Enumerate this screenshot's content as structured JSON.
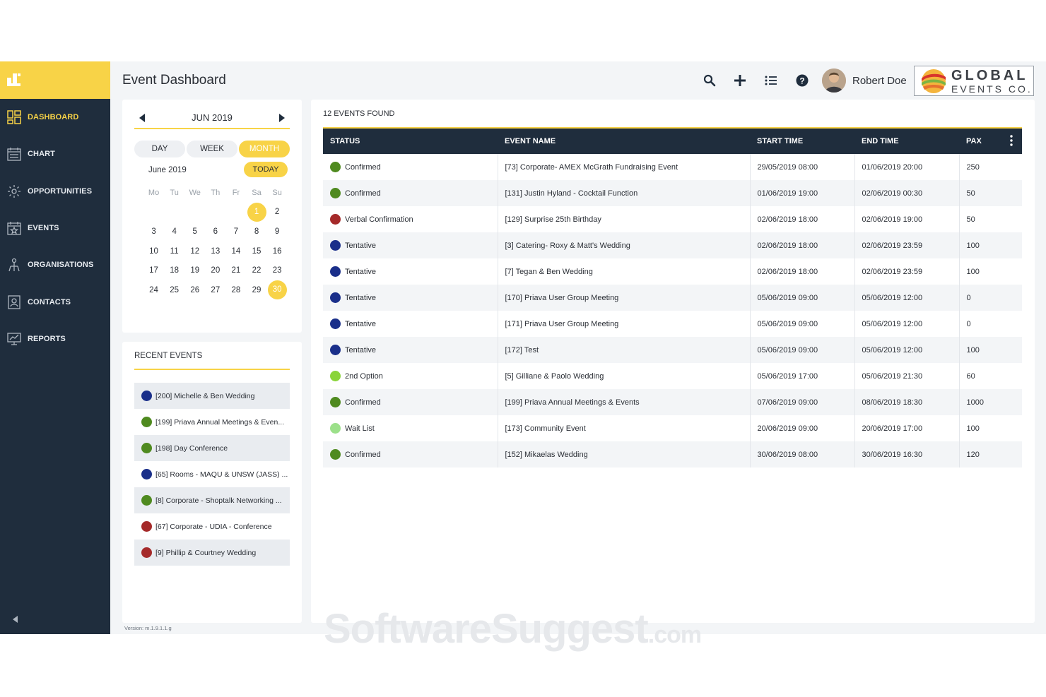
{
  "sidebar": {
    "items": [
      {
        "label": "DASHBOARD",
        "icon": "dashboard-icon",
        "active": true
      },
      {
        "label": "CHART",
        "icon": "chart-calendar-icon",
        "active": false
      },
      {
        "label": "OPPORTUNITIES",
        "icon": "opportunities-icon",
        "active": false
      },
      {
        "label": "EVENTS",
        "icon": "events-icon",
        "active": false
      },
      {
        "label": "ORGANISATIONS",
        "icon": "organisations-icon",
        "active": false
      },
      {
        "label": "CONTACTS",
        "icon": "contacts-icon",
        "active": false
      },
      {
        "label": "REPORTS",
        "icon": "reports-icon",
        "active": false
      }
    ]
  },
  "header": {
    "title": "Event Dashboard",
    "user_name": "Robert Doe",
    "brand_line1": "GLOBAL",
    "brand_line2": "EVENTS CO."
  },
  "calendar": {
    "month_label": "JUN 2019",
    "views": [
      "DAY",
      "WEEK",
      "MONTH"
    ],
    "active_view": "MONTH",
    "current_label": "June 2019",
    "today_label": "TODAY",
    "weekdays": [
      "Mo",
      "Tu",
      "We",
      "Th",
      "Fr",
      "Sa",
      "Su"
    ],
    "weeks": [
      [
        "",
        "",
        "",
        "",
        "",
        "1",
        "2"
      ],
      [
        "3",
        "4",
        "5",
        "6",
        "7",
        "8",
        "9"
      ],
      [
        "10",
        "11",
        "12",
        "13",
        "14",
        "15",
        "16"
      ],
      [
        "17",
        "18",
        "19",
        "20",
        "21",
        "22",
        "23"
      ],
      [
        "24",
        "25",
        "26",
        "27",
        "28",
        "29",
        "30"
      ]
    ],
    "highlighted_days": [
      "1",
      "30"
    ]
  },
  "recent": {
    "title": "RECENT EVENTS",
    "items": [
      {
        "label": "[200] Michelle & Ben Wedding",
        "color": "#1a2f8a"
      },
      {
        "label": "[199] Priava Annual Meetings & Even...",
        "color": "#4f8a1f"
      },
      {
        "label": "[198] Day Conference",
        "color": "#4f8a1f"
      },
      {
        "label": "[65] Rooms - MAQU & UNSW (JASS) ...",
        "color": "#1a2f8a"
      },
      {
        "label": "[8] Corporate - Shoptalk Networking ...",
        "color": "#4f8a1f"
      },
      {
        "label": "[67] Corporate - UDIA - Conference",
        "color": "#a52a2a"
      },
      {
        "label": "[9] Phillip & Courtney Wedding",
        "color": "#a52a2a"
      }
    ]
  },
  "version": "Version: m.1.9.1.1.g",
  "events": {
    "found_label": "12 EVENTS FOUND",
    "columns": [
      "STATUS",
      "EVENT NAME",
      "START TIME",
      "END TIME",
      "PAX"
    ],
    "rows": [
      {
        "status": "Confirmed",
        "color": "#4f8a1f",
        "name": "[73] Corporate- AMEX McGrath Fundraising Event",
        "start": "29/05/2019 08:00",
        "end": "01/06/2019 20:00",
        "pax": "250"
      },
      {
        "status": "Confirmed",
        "color": "#4f8a1f",
        "name": "[131] Justin Hyland - Cocktail Function",
        "start": "01/06/2019 19:00",
        "end": "02/06/2019 00:30",
        "pax": "50"
      },
      {
        "status": "Verbal Confirmation",
        "color": "#a52a2a",
        "name": "[129] Surprise 25th Birthday",
        "start": "02/06/2019 18:00",
        "end": "02/06/2019 19:00",
        "pax": "50"
      },
      {
        "status": "Tentative",
        "color": "#1a2f8a",
        "name": "[3] Catering- Roxy & Matt's Wedding",
        "start": "02/06/2019 18:00",
        "end": "02/06/2019 23:59",
        "pax": "100"
      },
      {
        "status": "Tentative",
        "color": "#1a2f8a",
        "name": "[7] Tegan & Ben Wedding",
        "start": "02/06/2019 18:00",
        "end": "02/06/2019 23:59",
        "pax": "100"
      },
      {
        "status": "Tentative",
        "color": "#1a2f8a",
        "name": "[170] Priava User Group Meeting",
        "start": "05/06/2019 09:00",
        "end": "05/06/2019 12:00",
        "pax": "0"
      },
      {
        "status": "Tentative",
        "color": "#1a2f8a",
        "name": "[171] Priava User Group Meeting",
        "start": "05/06/2019 09:00",
        "end": "05/06/2019 12:00",
        "pax": "0"
      },
      {
        "status": "Tentative",
        "color": "#1a2f8a",
        "name": "[172] Test",
        "start": "05/06/2019 09:00",
        "end": "05/06/2019 12:00",
        "pax": "100"
      },
      {
        "status": "2nd Option",
        "color": "#8ad43a",
        "name": "[5] Gilliane & Paolo Wedding",
        "start": "05/06/2019 17:00",
        "end": "05/06/2019 21:30",
        "pax": "60"
      },
      {
        "status": "Confirmed",
        "color": "#4f8a1f",
        "name": "[199] Priava Annual Meetings & Events",
        "start": "07/06/2019 09:00",
        "end": "08/06/2019 18:30",
        "pax": "1000"
      },
      {
        "status": "Wait List",
        "color": "#9ce08a",
        "name": "[173] Community Event",
        "start": "20/06/2019 09:00",
        "end": "20/06/2019 17:00",
        "pax": "100"
      },
      {
        "status": "Confirmed",
        "color": "#4f8a1f",
        "name": "[152] Mikaelas Wedding",
        "start": "30/06/2019 08:00",
        "end": "30/06/2019 16:30",
        "pax": "120"
      }
    ]
  },
  "watermark": {
    "main": "SoftwareSuggest",
    "suffix": ".com"
  },
  "colors": {
    "accent": "#f8d347",
    "sidebar": "#1f2d3d",
    "confirmed": "#4f8a1f",
    "tentative": "#1a2f8a",
    "verbal": "#a52a2a"
  }
}
